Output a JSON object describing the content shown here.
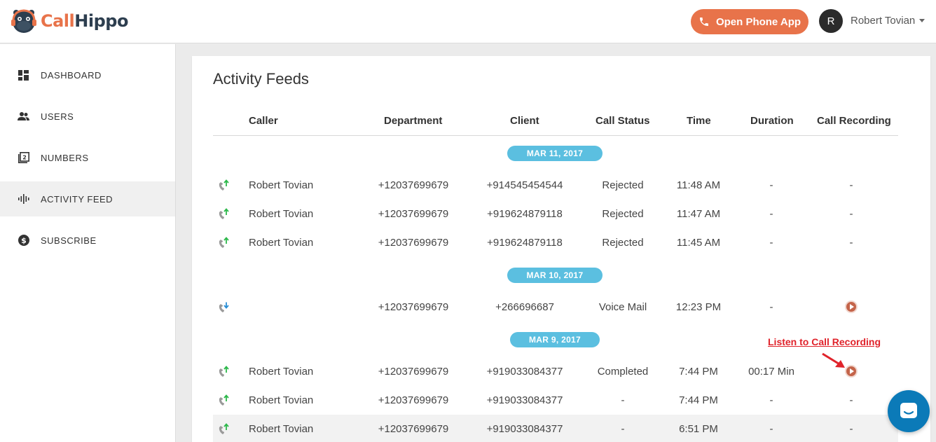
{
  "brand": {
    "logo_call": "Call",
    "logo_hippo": "Hippo"
  },
  "header": {
    "open_phone_label": "Open Phone App",
    "avatar_initial": "R",
    "user_name": "Robert Tovian"
  },
  "sidebar": {
    "items": [
      {
        "label": "DASHBOARD",
        "icon": "dashboard-icon",
        "active": false
      },
      {
        "label": "USERS",
        "icon": "users-icon",
        "active": false
      },
      {
        "label": "NUMBERS",
        "icon": "numbers-icon",
        "active": false
      },
      {
        "label": "ACTIVITY FEED",
        "icon": "activity-feed-icon",
        "active": true
      },
      {
        "label": "SUBSCRIBE",
        "icon": "dollar-icon",
        "active": false
      }
    ]
  },
  "main": {
    "title": "Activity Feeds",
    "columns": [
      "Caller",
      "Department",
      "Client",
      "Call Status",
      "Time",
      "Duration",
      "Call Recording"
    ],
    "groups": [
      {
        "date": "MAR 11, 2017",
        "rows": [
          {
            "direction": "outgoing",
            "caller": "Robert Tovian",
            "department": "+12037699679",
            "client": "+914545454544",
            "status": "Rejected",
            "time": "11:48 AM",
            "duration": "-",
            "recording": "-"
          },
          {
            "direction": "outgoing",
            "caller": "Robert Tovian",
            "department": "+12037699679",
            "client": "+919624879118",
            "status": "Rejected",
            "time": "11:47 AM",
            "duration": "-",
            "recording": "-"
          },
          {
            "direction": "outgoing",
            "caller": "Robert Tovian",
            "department": "+12037699679",
            "client": "+919624879118",
            "status": "Rejected",
            "time": "11:45 AM",
            "duration": "-",
            "recording": "-"
          }
        ]
      },
      {
        "date": "MAR 10, 2017",
        "rows": [
          {
            "direction": "incoming",
            "caller": "",
            "department": "+12037699679",
            "client": "+266696687",
            "status": "Voice Mail",
            "time": "12:23 PM",
            "duration": "-",
            "recording": "play"
          }
        ]
      },
      {
        "date": "MAR 9, 2017",
        "rows": [
          {
            "direction": "outgoing",
            "caller": "Robert Tovian",
            "department": "+12037699679",
            "client": "+919033084377",
            "status": "Completed",
            "time": "7:44 PM",
            "duration": "00:17 Min",
            "recording": "play"
          },
          {
            "direction": "outgoing",
            "caller": "Robert Tovian",
            "department": "+12037699679",
            "client": "+919033084377",
            "status": "-",
            "time": "7:44 PM",
            "duration": "-",
            "recording": "-"
          },
          {
            "direction": "outgoing",
            "caller": "Robert Tovian",
            "department": "+12037699679",
            "client": "+919033084377",
            "status": "-",
            "time": "6:51 PM",
            "duration": "-",
            "recording": "-"
          }
        ]
      }
    ]
  },
  "annotation": {
    "text": "Listen to Call Recording"
  },
  "colors": {
    "accent": "#e8734a",
    "date_pill": "#5bbfe0",
    "play": "#c4644a",
    "chat": "#0b7ab8",
    "outgoing_arrow": "#2db84b",
    "incoming_arrow": "#2a8fd6"
  },
  "chat_widget": {
    "icon": "chat-icon"
  }
}
